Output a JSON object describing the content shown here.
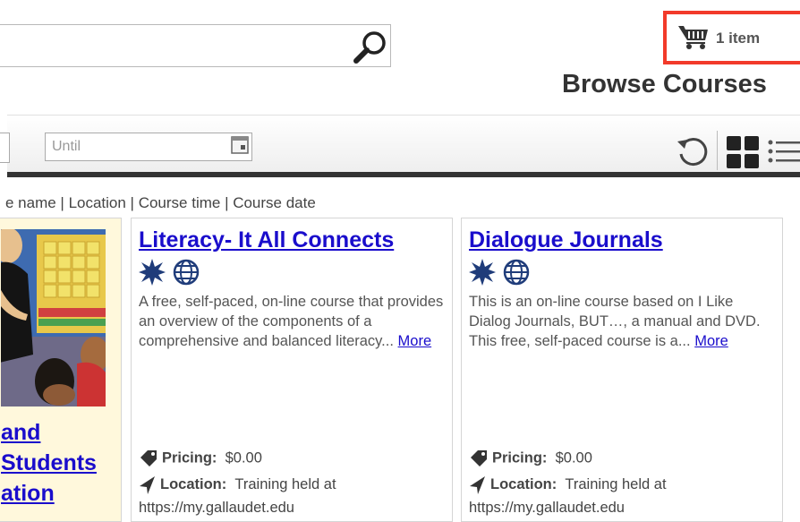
{
  "search": {
    "placeholder": ""
  },
  "cart": {
    "label": "1 item"
  },
  "page_title": "Browse Courses",
  "filters": {
    "until_placeholder": "Until"
  },
  "sort": {
    "text": "e name | Location | Course time | Course date"
  },
  "colors": {
    "link": "#1a0dcc",
    "cart_border": "#f23a2a",
    "card1_bg": "#fff8dc"
  },
  "icons": [
    "search-icon",
    "cart-icon",
    "calendar-icon",
    "refresh-icon",
    "grid-view-icon",
    "list-view-icon",
    "star-burst-icon",
    "globe-icon",
    "price-tag-icon",
    "location-arrow-icon"
  ],
  "cards": [
    {
      "title_lines": [
        "and",
        "Students",
        "ation"
      ]
    },
    {
      "title": "Literacy- It All Connects",
      "description": "A free, self-paced, on-line course that provides an overview of the components of a comprehensive and balanced literacy...",
      "more": "More",
      "pricing_label": "Pricing:",
      "pricing_value": "$0.00",
      "location_label": "Location:",
      "location_value": "Training held at https://my.gallaudet.edu"
    },
    {
      "title": "Dialogue Journals",
      "description": "This is an on-line course based on I Like Dialog Journals, BUT…, a manual and DVD. This free, self-paced course is a...",
      "more": "More",
      "pricing_label": "Pricing:",
      "pricing_value": "$0.00",
      "location_label": "Location:",
      "location_value": "Training held at https://my.gallaudet.edu"
    }
  ]
}
